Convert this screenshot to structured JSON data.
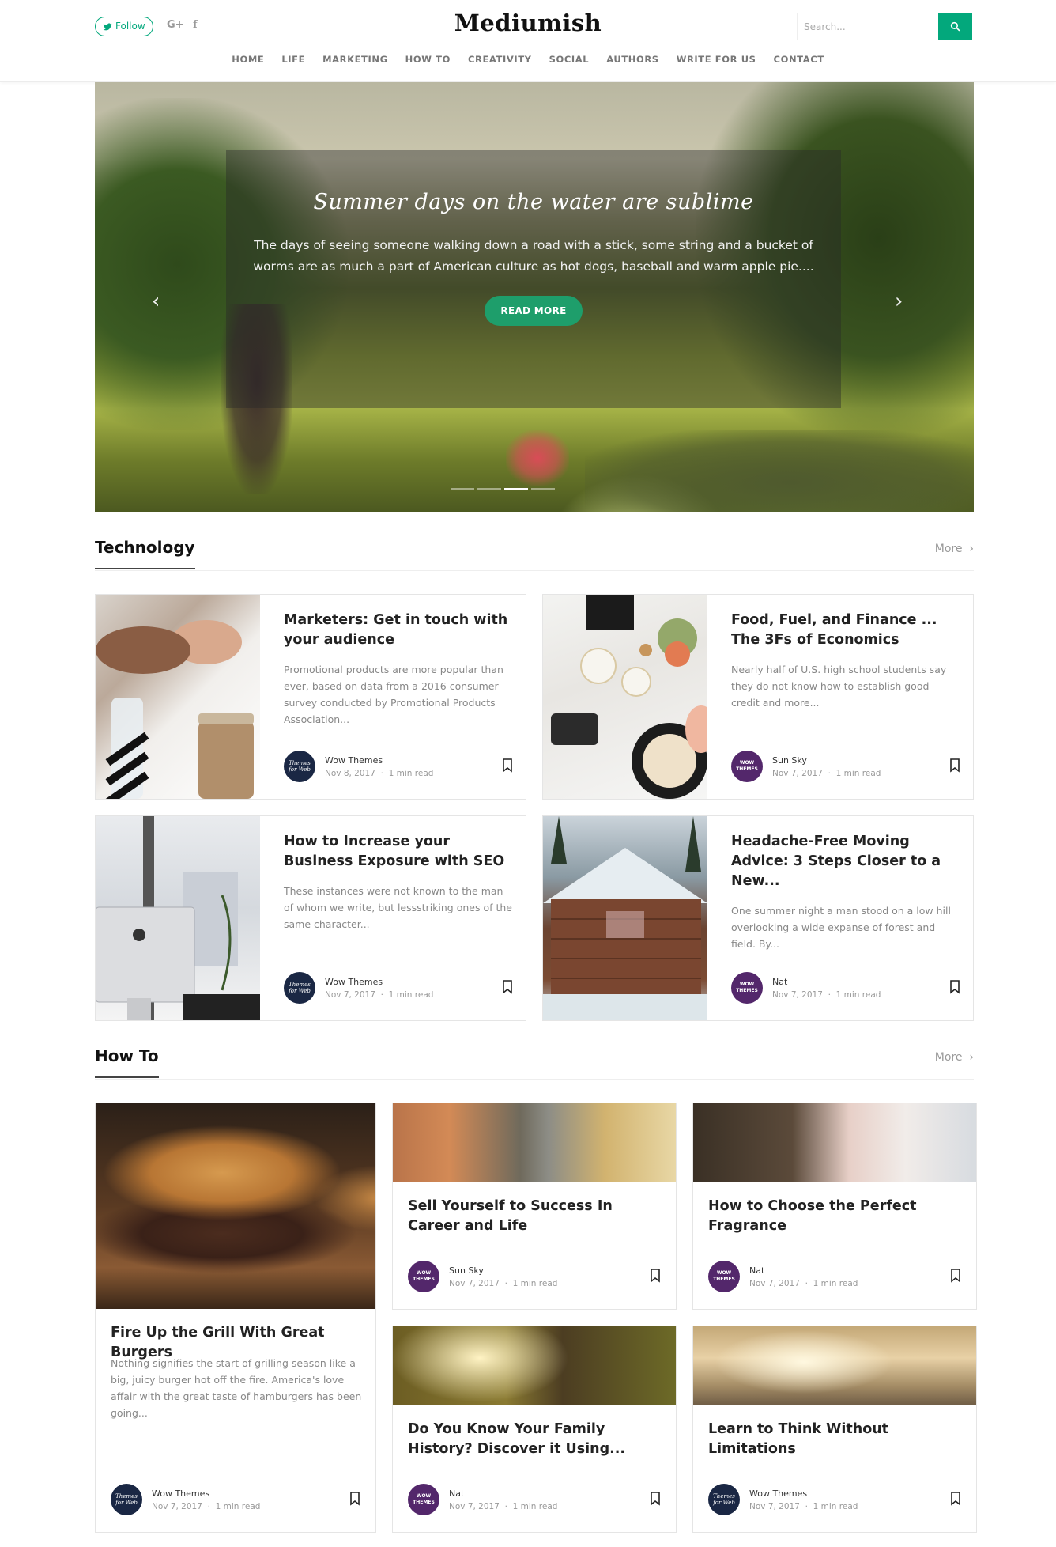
{
  "header": {
    "follow_label": "Follow",
    "logo": "Mediumish",
    "search_placeholder": "Search...",
    "gplus": "G+",
    "facebook": "f",
    "nav": [
      "HOME",
      "LIFE",
      "MARKETING",
      "HOW TO",
      "CREATIVITY",
      "SOCIAL",
      "AUTHORS",
      "WRITE FOR US",
      "CONTACT"
    ]
  },
  "hero": {
    "title": "Summer days on the water are sublime",
    "excerpt": "The days of seeing someone walking down a road with a stick, some string and a bucket of worms  are as much a part of American culture as hot dogs, baseball and warm apple pie....",
    "button": "READ MORE",
    "slide_count": 4,
    "active_slide": 3
  },
  "technology": {
    "heading": "Technology",
    "more": "More",
    "cards": [
      {
        "title": "Marketers: Get in touch with your audience",
        "excerpt": "Promotional products are more popular than ever, based on data from a 2016 consumer survey conducted by Promotional Products Association...",
        "author": "Wow Themes",
        "date": "Nov 8, 2017",
        "read": "1 min read"
      },
      {
        "title": "Food, Fuel, and Finance ... The 3Fs of Economics",
        "excerpt": "Nearly half of U.S. high school students say they do not know how to establish good credit and more...",
        "author": "Sun Sky",
        "date": "Nov 7, 2017",
        "read": "1 min read"
      },
      {
        "title": "How to Increase your Business Exposure with SEO",
        "excerpt": "These instances were not known to the man of whom we write, but lessstriking ones of the same character...",
        "author": "Wow Themes",
        "date": "Nov 7, 2017",
        "read": "1 min read"
      },
      {
        "title": "Headache-Free Moving Advice: 3 Steps Closer to a New...",
        "excerpt": "One summer night a man stood on a low hill overlooking a wide expanse of forest and field. By...",
        "author": "Nat",
        "date": "Nov 7, 2017",
        "read": "1 min read"
      }
    ]
  },
  "howto": {
    "heading": "How To",
    "more": "More",
    "featured": {
      "title": "Fire Up the Grill With Great Burgers",
      "excerpt": "Nothing signifies the start of grilling season like a big, juicy burger hot off the fire. America's love affair with the great taste of hamburgers has been going...",
      "author": "Wow Themes",
      "date": "Nov 7, 2017",
      "read": "1 min read"
    },
    "cards": [
      {
        "title": "Sell Yourself to Success In Career and Life",
        "author": "Sun Sky",
        "date": "Nov 7, 2017",
        "read": "1 min read"
      },
      {
        "title": "How to Choose the Perfect Fragrance",
        "author": "Nat",
        "date": "Nov 7, 2017",
        "read": "1 min read"
      },
      {
        "title": "Do You Know Your Family History? Discover it Using...",
        "author": "Nat",
        "date": "Nov 7, 2017",
        "read": "1 min read"
      },
      {
        "title": "Learn to Think Without Limitations",
        "author": "Wow Themes",
        "date": "Nov 7, 2017",
        "read": "1 min read"
      }
    ]
  },
  "avatars": {
    "wow_themes": "Themes for Web",
    "wow": "WOW THEMES"
  },
  "meta_separator": "·",
  "colors": {
    "accent": "#03a87c",
    "button": "#1e9e6b",
    "avatar_navy": "#1a2744",
    "avatar_purple": "#53276b"
  },
  "icons": {
    "search": "search-icon",
    "bookmark": "bookmark-icon",
    "twitter": "twitter-icon",
    "prev": "chevron-left-icon",
    "next": "chevron-right-icon"
  }
}
